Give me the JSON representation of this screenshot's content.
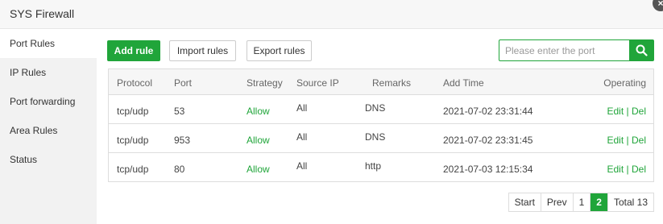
{
  "window": {
    "title": "SYS Firewall"
  },
  "sidebar": {
    "items": [
      {
        "label": "Port Rules",
        "active": true
      },
      {
        "label": "IP Rules",
        "active": false
      },
      {
        "label": "Port forwarding",
        "active": false
      },
      {
        "label": "Area Rules",
        "active": false
      },
      {
        "label": "Status",
        "active": false
      }
    ]
  },
  "toolbar": {
    "add_label": "Add rule",
    "import_label": "Import rules",
    "export_label": "Export rules",
    "search_placeholder": "Please enter the port",
    "search_icon": "search-icon"
  },
  "table": {
    "headers": {
      "protocol": "Protocol",
      "port": "Port",
      "strategy": "Strategy",
      "source_ip": "Source IP",
      "remarks": "Remarks",
      "add_time": "Add Time",
      "operating": "Operating"
    },
    "rows": [
      {
        "protocol": "tcp/udp",
        "port": "53",
        "strategy": "Allow",
        "source_ip": "All",
        "remarks": "DNS",
        "add_time": "2021-07-02 23:31:44",
        "edit": "Edit",
        "sep": "|",
        "del": "Del"
      },
      {
        "protocol": "tcp/udp",
        "port": "953",
        "strategy": "Allow",
        "source_ip": "All",
        "remarks": "DNS",
        "add_time": "2021-07-02 23:31:45",
        "edit": "Edit",
        "sep": "|",
        "del": "Del"
      },
      {
        "protocol": "tcp/udp",
        "port": "80",
        "strategy": "Allow",
        "source_ip": "All",
        "remarks": "http",
        "add_time": "2021-07-03 12:15:34",
        "edit": "Edit",
        "sep": "|",
        "del": "Del"
      }
    ]
  },
  "pagination": {
    "start": "Start",
    "prev": "Prev",
    "pages": [
      "1",
      "2"
    ],
    "current": "2",
    "total": "Total 13"
  },
  "colors": {
    "accent": "#20a53a",
    "sidebar_bg": "#f2f2f2",
    "header_bg": "#f6f6f6"
  }
}
